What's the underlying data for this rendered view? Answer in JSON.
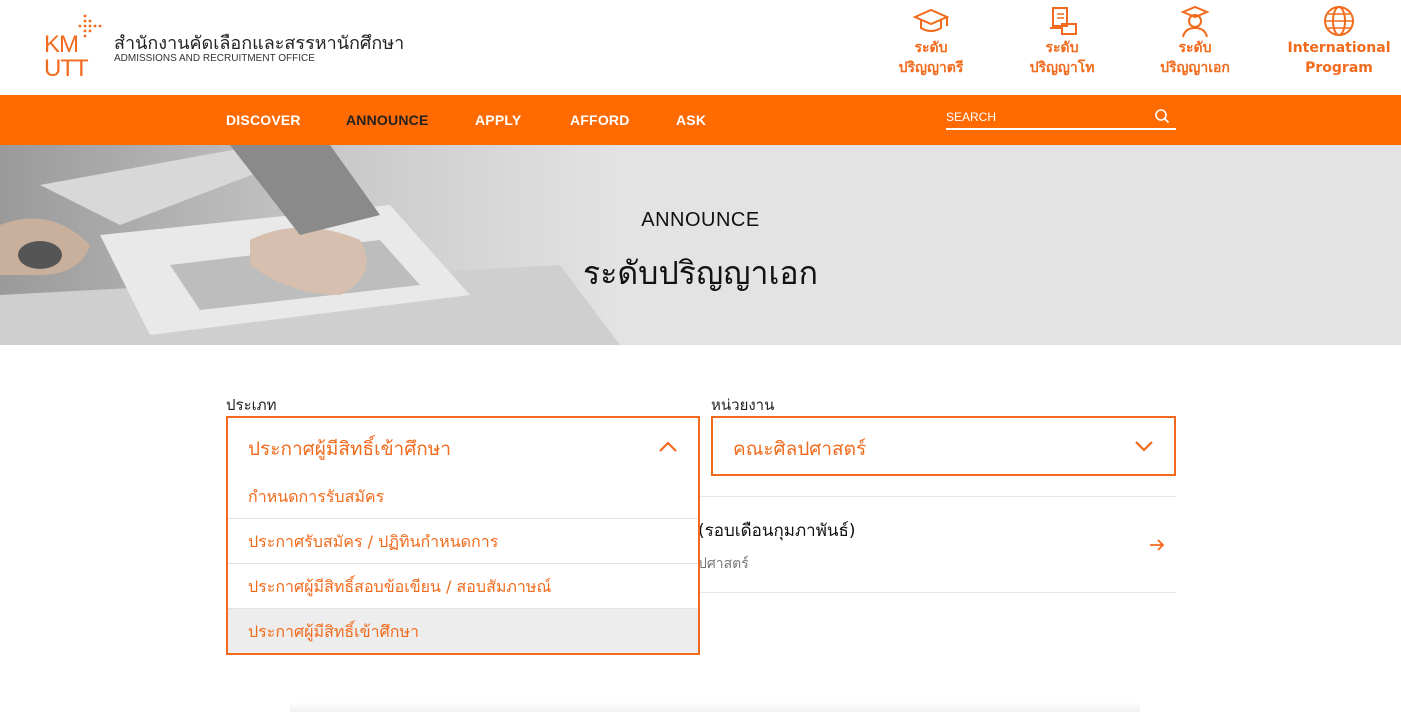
{
  "brand": {
    "logo_text": "KMUTT",
    "name_th": "สำนักงานคัดเลือกและสรรหานักศึกษา",
    "name_en": "ADMISSIONS AND RECRUITMENT OFFICE"
  },
  "levels": [
    {
      "line1": "ระดับ",
      "line2": "ปริญญาตรี",
      "icon": "graduation-cap-icon"
    },
    {
      "line1": "ระดับ",
      "line2": "ปริญญาโท",
      "icon": "diploma-icon"
    },
    {
      "line1": "ระดับ",
      "line2": "ปริญญาเอก",
      "icon": "graduate-person-icon"
    },
    {
      "line1": "International",
      "line2": "Program",
      "icon": "globe-icon"
    }
  ],
  "nav": {
    "items": [
      "DISCOVER",
      "ANNOUNCE",
      "APPLY",
      "AFFORD",
      "ASK"
    ],
    "active": "ANNOUNCE",
    "search_placeholder": "SEARCH"
  },
  "hero": {
    "subtitle": "ANNOUNCE",
    "title": "ระดับปริญญาเอก"
  },
  "filters": {
    "type_label": "ประเภท",
    "type_value": "ประกาศผู้มีสิทธิ์เข้าศึกษา",
    "unit_label": "หน่วยงาน",
    "unit_value": "คณะศิลปศาสตร์",
    "type_options": [
      "กำหนดการรับสมัคร",
      "ประกาศรับสมัคร / ปฏิทินกำหนดการ",
      "ประกาศผู้มีสิทธิ์สอบข้อเขียน / สอบสัมภาษณ์",
      "ประกาศผู้มีสิทธิ์เข้าศึกษา"
    ],
    "selected_index": 3
  },
  "results": [
    {
      "title": "(รอบเดือนกุมภาพันธ์)",
      "meta": "ปศาสตร์"
    }
  ],
  "colors": {
    "accent": "#ff6b00",
    "accent_text": "#f26b1d",
    "hero_bg": "#e3e3e3"
  }
}
